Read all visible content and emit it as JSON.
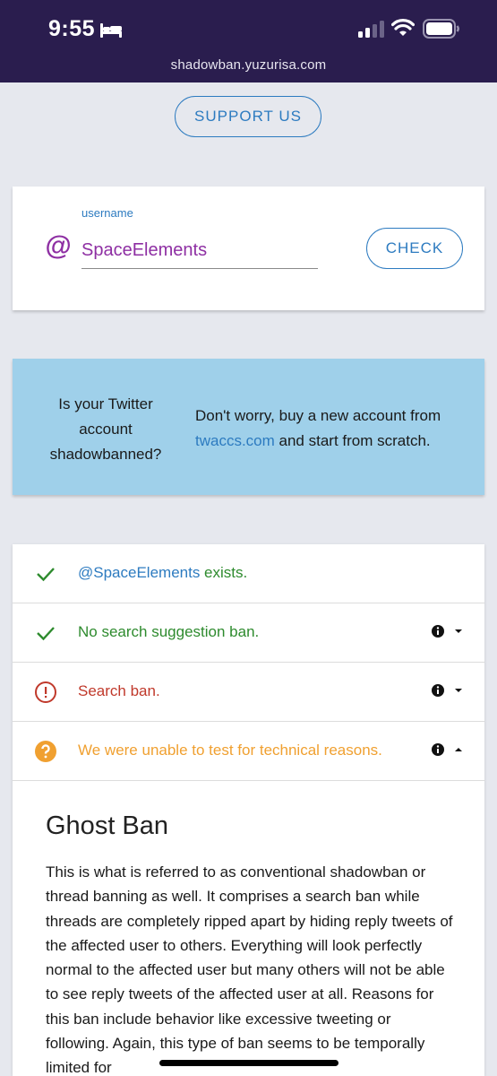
{
  "status": {
    "time": "9:55",
    "url": "shadowban.yuzurisa.com"
  },
  "support_button": "SUPPORT US",
  "form": {
    "label": "username",
    "value": "SpaceElements",
    "at_symbol": "@",
    "check_button": "CHECK"
  },
  "ad": {
    "left_text": "Is your Twitter account shadowbanned?",
    "right_text_before": "Don't worry, buy a new account from ",
    "link": "twaccs.com",
    "right_text_after": " and start from scratch."
  },
  "results": {
    "exists_handle": "@SpaceElements",
    "exists_suffix": " exists.",
    "suggestion_ban": "No search suggestion ban.",
    "search_ban": "Search ban.",
    "ghost_ban_status": "We were unable to test for technical reasons."
  },
  "detail": {
    "title": "Ghost Ban",
    "body": "This is what is referred to as conventional shadowban or thread banning as well. It comprises a search ban while threads are completely ripped apart by hiding reply tweets of the affected user to others. Everything will look perfectly normal to the affected user but many others will not be able to see reply tweets of the affected user at all. Reasons for this ban include behavior like excessive tweeting or following. Again, this type of ban seems to be temporally limited for"
  },
  "colors": {
    "status_bar": "#2a1d4e",
    "accent_blue": "#2d7bc0",
    "purple": "#8e2fa3",
    "success_green": "#2e8b2e",
    "error_red": "#c0392b",
    "warning_orange": "#f0a030",
    "ad_background": "#9fd0ea"
  },
  "icons": [
    "bed-icon",
    "signal-icon",
    "wifi-icon",
    "battery-icon",
    "check-icon",
    "alert-circle-icon",
    "help-circle-icon",
    "info-icon",
    "chevron-down-icon",
    "chevron-up-icon"
  ]
}
